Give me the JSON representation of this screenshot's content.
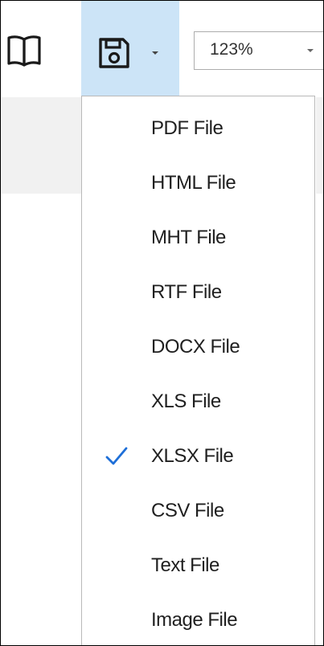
{
  "toolbar": {
    "book_icon": "book-open-icon",
    "save_icon": "floppy-disk-icon",
    "zoom": {
      "value": "123%"
    }
  },
  "save_menu": {
    "items": [
      {
        "label": "PDF File",
        "checked": false
      },
      {
        "label": "HTML File",
        "checked": false
      },
      {
        "label": "MHT File",
        "checked": false
      },
      {
        "label": "RTF File",
        "checked": false
      },
      {
        "label": "DOCX File",
        "checked": false
      },
      {
        "label": "XLS File",
        "checked": false
      },
      {
        "label": "XLSX File",
        "checked": true
      },
      {
        "label": "CSV File",
        "checked": false
      },
      {
        "label": "Text File",
        "checked": false
      },
      {
        "label": "Image File",
        "checked": false
      }
    ]
  },
  "colors": {
    "highlight": "#cce4f7",
    "checkmark": "#1e6fd8",
    "menu_border": "#b9b9b9"
  }
}
